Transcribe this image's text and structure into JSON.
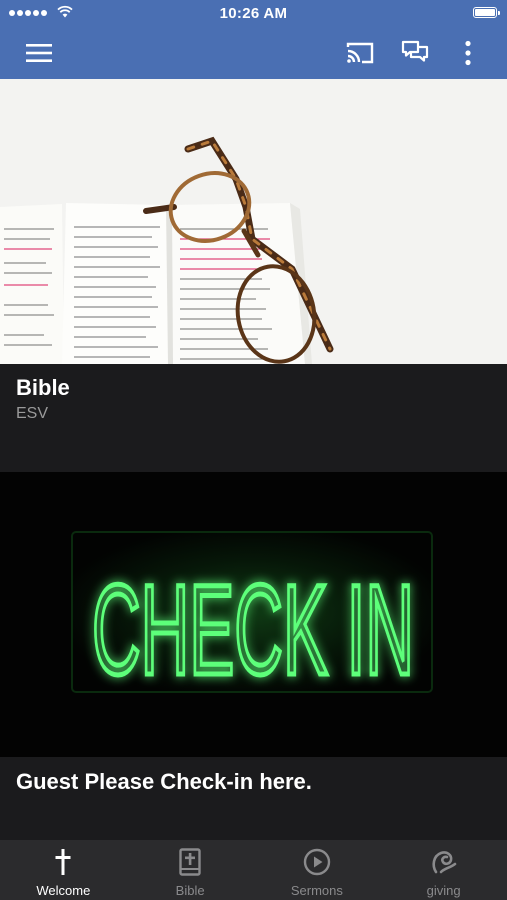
{
  "status_bar": {
    "time": "10:26 AM"
  },
  "app_bar": {
    "icons": [
      "menu-icon",
      "cast-icon",
      "chat-icon",
      "more-vertical-icon"
    ]
  },
  "cards": [
    {
      "title": "Bible",
      "subtitle": "ESV",
      "image": "open-bible-with-glasses"
    },
    {
      "title": "Guest Please Check-in here.",
      "image_text": "CHECK IN"
    }
  ],
  "tabs": [
    {
      "label": "Welcome",
      "icon": "cross-icon",
      "active": true
    },
    {
      "label": "Bible",
      "icon": "bible-book-icon",
      "active": false
    },
    {
      "label": "Sermons",
      "icon": "play-circle-icon",
      "active": false
    },
    {
      "label": "giving",
      "icon": "giving-icon",
      "active": false
    }
  ],
  "colors": {
    "header": "#4a6fb3",
    "background": "#1b1b1d",
    "tab_bar": "#2b2b2d",
    "neon_green": "#4dff6a"
  }
}
